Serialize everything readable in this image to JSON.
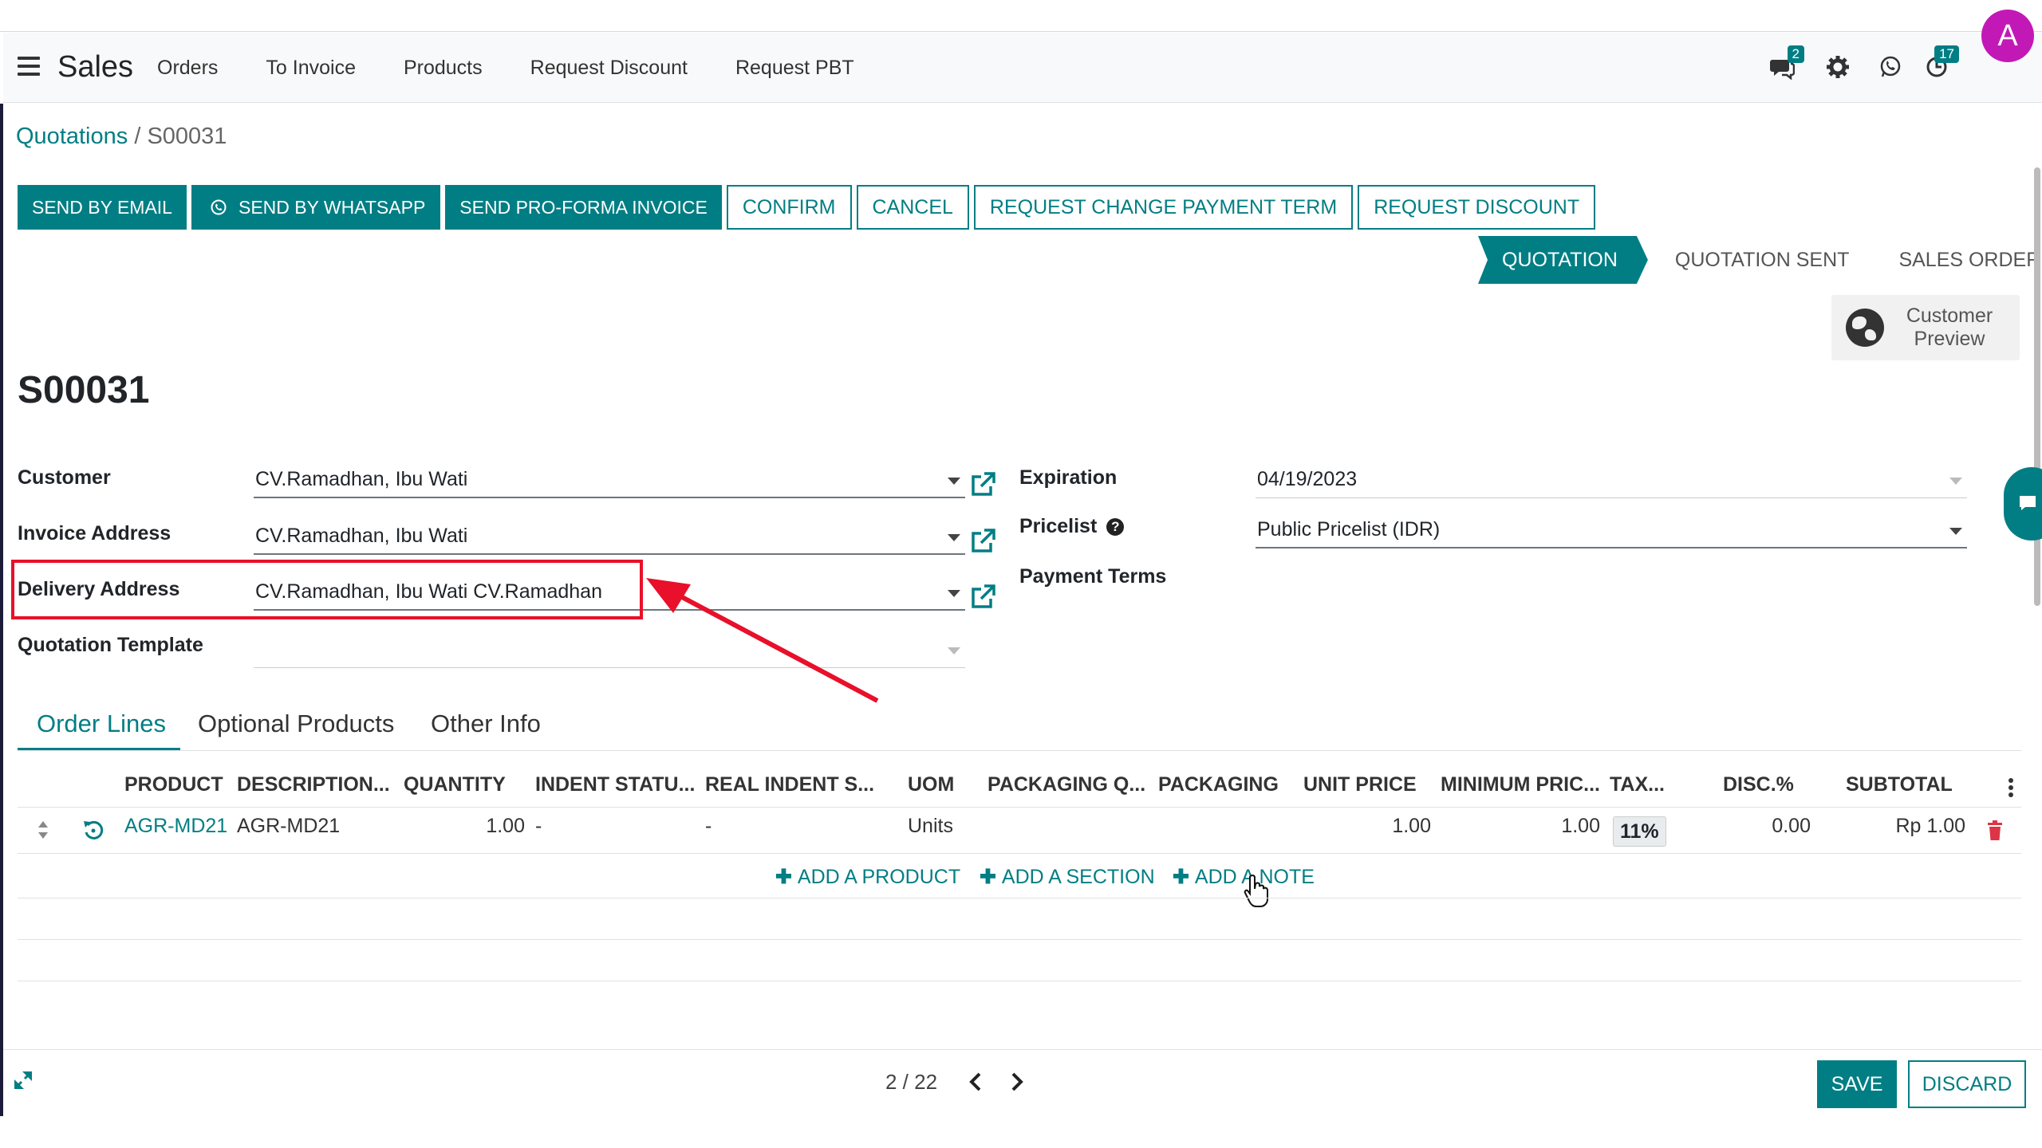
{
  "navbar": {
    "app_name": "Sales",
    "menu": [
      "Orders",
      "To Invoice",
      "Products",
      "Request Discount",
      "Request PBT"
    ],
    "messages_count": "2",
    "activities_count": "17",
    "avatar_letter": "A",
    "avatar_color": "#c219b6"
  },
  "breadcrumb": {
    "parent": "Quotations",
    "separator": "/",
    "current": "S00031"
  },
  "actions": {
    "send_email": "SEND BY EMAIL",
    "send_whatsapp": "SEND BY WHATSAPP",
    "send_proforma": "SEND PRO-FORMA INVOICE",
    "confirm": "CONFIRM",
    "cancel": "CANCEL",
    "change_payment_term": "REQUEST CHANGE PAYMENT TERM",
    "request_discount": "REQUEST DISCOUNT"
  },
  "status": {
    "stages": [
      "QUOTATION",
      "QUOTATION SENT",
      "SALES ORDER"
    ],
    "active": "QUOTATION"
  },
  "customer_preview": {
    "line1": "Customer",
    "line2": "Preview"
  },
  "record_title": "S00031",
  "form": {
    "customer": {
      "label": "Customer",
      "value": "CV.Ramadhan, Ibu Wati"
    },
    "invoice_address": {
      "label": "Invoice Address",
      "value": "CV.Ramadhan, Ibu Wati"
    },
    "delivery_address": {
      "label": "Delivery Address",
      "value": "CV.Ramadhan, Ibu Wati CV.Ramadhan"
    },
    "quotation_template": {
      "label": "Quotation Template",
      "value": ""
    },
    "expiration": {
      "label": "Expiration",
      "value": "04/19/2023"
    },
    "pricelist": {
      "label": "Pricelist",
      "help": "?",
      "value": "Public Pricelist (IDR)"
    },
    "payment_terms": {
      "label": "Payment Terms",
      "value": ""
    }
  },
  "tabs": [
    "Order Lines",
    "Optional Products",
    "Other Info"
  ],
  "table": {
    "columns": [
      "PRODUCT",
      "DESCRIPTION...",
      "QUANTITY",
      "INDENT STATU...",
      "REAL INDENT S...",
      "UOM",
      "PACKAGING Q...",
      "PACKAGING",
      "UNIT PRICE",
      "MINIMUM PRIC...",
      "TAX...",
      "DISC.%",
      "SUBTOTAL"
    ],
    "rows": [
      {
        "product": "AGR-MD21",
        "description": "AGR-MD21",
        "quantity": "1.00",
        "indent_status": "-",
        "real_indent": "-",
        "uom": "Units",
        "packaging_qty": "",
        "packaging": "",
        "unit_price": "1.00",
        "minimum_price": "1.00",
        "tax": "11%",
        "discount": "0.00",
        "subtotal": "Rp 1.00"
      }
    ],
    "add_product": "ADD A PRODUCT",
    "add_section": "ADD A SECTION",
    "add_note": "ADD A NOTE"
  },
  "pager": {
    "text": "2 / 22"
  },
  "footer": {
    "save": "SAVE",
    "discard": "DISCARD"
  },
  "colors": {
    "primary": "#017e84",
    "annotation": "#e8102a"
  }
}
